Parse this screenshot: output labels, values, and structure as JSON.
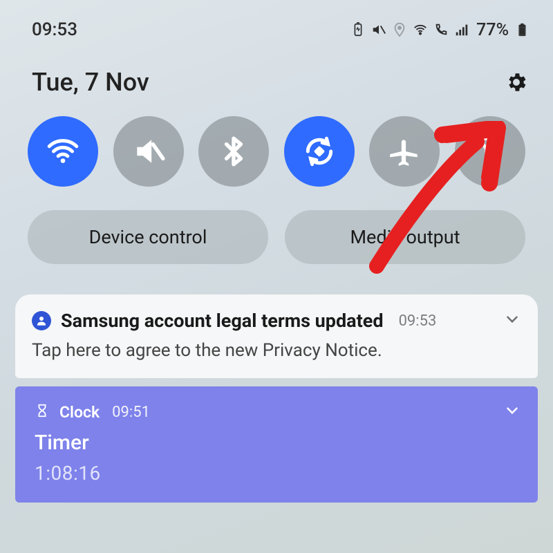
{
  "statusbar": {
    "time": "09:53",
    "battery_text": "77%"
  },
  "date": "Tue, 7 Nov",
  "pills": {
    "device_control": "Device control",
    "media_output": "Media output"
  },
  "notif1": {
    "title": "Samsung account legal terms updated",
    "time": "09:53",
    "body": "Tap here to agree to the new Privacy Notice."
  },
  "notif2": {
    "app": "Clock",
    "time": "09:51",
    "title": "Timer",
    "countdown": "1:08:16"
  }
}
